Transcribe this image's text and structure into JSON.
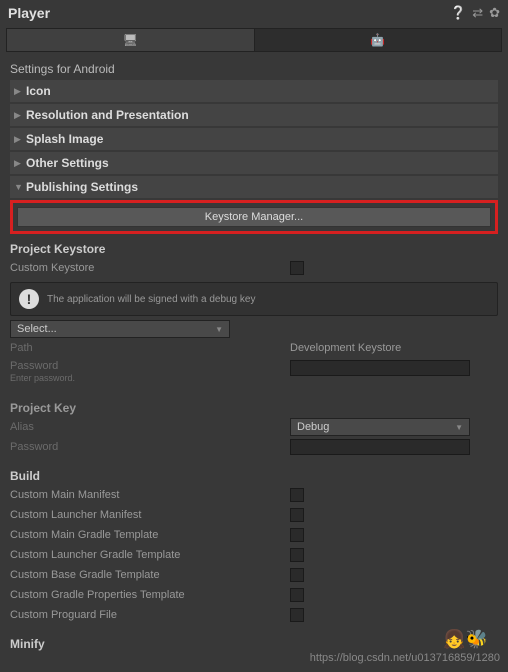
{
  "header": {
    "title": "Player",
    "icons": {
      "help": "❔",
      "presets": "⇄",
      "settings": "✿"
    }
  },
  "tabs": {
    "standalone": "🖥",
    "android": "🤖"
  },
  "settingsFor": "Settings for Android",
  "sections": {
    "icon": "Icon",
    "resolution": "Resolution and Presentation",
    "splash": "Splash Image",
    "other": "Other Settings",
    "publishing": "Publishing Settings"
  },
  "publishing": {
    "keystoreBtn": "Keystore Manager...",
    "projectKeystore": "Project Keystore",
    "customKeystore": "Custom Keystore",
    "infoText": "The application will be signed with a debug key",
    "selectLabel": "Select...",
    "pathLabel": "Path",
    "pathValue": "Development Keystore",
    "passwordLabel": "Password",
    "passwordHint": "Enter password.",
    "projectKey": "Project Key",
    "aliasLabel": "Alias",
    "aliasValue": "Debug"
  },
  "build": {
    "title": "Build",
    "items": [
      "Custom Main Manifest",
      "Custom Launcher Manifest",
      "Custom Main Gradle Template",
      "Custom Launcher Gradle Template",
      "Custom Base Gradle Template",
      "Custom Gradle Properties Template",
      "Custom Proguard File"
    ]
  },
  "minify": "Minify",
  "watermark": "https://blog.csdn.net/u013716859/1280",
  "avatar": "👧🐝"
}
